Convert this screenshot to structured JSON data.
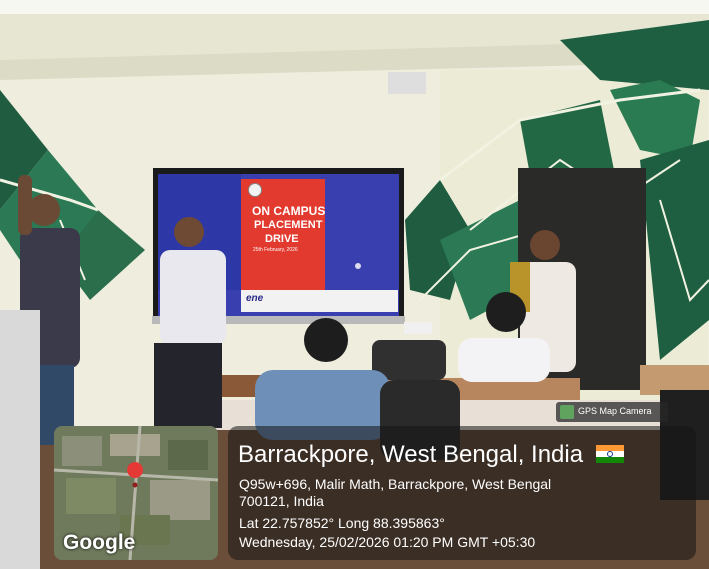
{
  "photo": {
    "caption": "On-campus placement drive presentation in a classroom"
  },
  "slide": {
    "headline_1": "ON CAMPUS",
    "headline_2": "PLACEMENT",
    "headline_3": "DRIVE",
    "date": "25th February, 2026",
    "brand": "ene"
  },
  "gps_overlay": {
    "camera_badge": "GPS Map Camera",
    "location_title": "Barrackpore, West Bengal, India",
    "address_line_1": "Q95w+696, Malir Math, Barrackpore, West Bengal",
    "address_line_2": "700121, India",
    "coordinates": "Lat 22.757852° Long 88.395863°",
    "datetime": "Wednesday, 25/02/2026 01:20 PM GMT +05:30",
    "map_provider": "Google",
    "flag_colors": [
      "#ff9933",
      "#ffffff",
      "#138808"
    ],
    "pin_color": "#e53935"
  }
}
